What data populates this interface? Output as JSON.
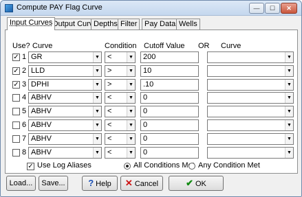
{
  "window": {
    "title": "Compute PAY Flag Curve",
    "min_glyph": "—",
    "max_glyph": "☐",
    "close_glyph": "✕"
  },
  "tabs": [
    "Input Curves",
    "Output Curve",
    "Depths",
    "Filter",
    "Pay Data",
    "Wells"
  ],
  "headers": {
    "use": "Use?",
    "curve": "Curve",
    "condition": "Condition",
    "cutoff": "Cutoff Value",
    "or": "OR",
    "curve2": "Curve"
  },
  "rows": [
    {
      "checked": true,
      "num": "1",
      "curve": "GR",
      "condition": "<",
      "cutoff": "200",
      "alt_curve": ""
    },
    {
      "checked": true,
      "num": "2",
      "curve": "LLD",
      "condition": ">",
      "cutoff": "10",
      "alt_curve": ""
    },
    {
      "checked": true,
      "num": "3",
      "curve": "DPHI",
      "condition": ">",
      "cutoff": ".10",
      "alt_curve": ""
    },
    {
      "checked": false,
      "num": "4",
      "curve": "ABHV",
      "condition": "<",
      "cutoff": "0",
      "alt_curve": ""
    },
    {
      "checked": false,
      "num": "5",
      "curve": "ABHV",
      "condition": "<",
      "cutoff": "0",
      "alt_curve": ""
    },
    {
      "checked": false,
      "num": "6",
      "curve": "ABHV",
      "condition": "<",
      "cutoff": "0",
      "alt_curve": ""
    },
    {
      "checked": false,
      "num": "7",
      "curve": "ABHV",
      "condition": "<",
      "cutoff": "0",
      "alt_curve": ""
    },
    {
      "checked": false,
      "num": "8",
      "curve": "ABHV",
      "condition": "<",
      "cutoff": "0",
      "alt_curve": ""
    }
  ],
  "options": {
    "use_log_aliases": "Use Log Aliases",
    "use_log_aliases_checked": true,
    "all_conditions": "All Conditions Met",
    "any_condition": "Any Condition Met",
    "selected_mode": "all"
  },
  "buttons": {
    "load": "Load...",
    "save": "Save...",
    "help": "Help",
    "cancel": "Cancel",
    "ok": "OK",
    "help_icon": "?",
    "cancel_icon": "✕",
    "ok_icon": "✔"
  },
  "colors": {
    "help_icon": "#1a4fb5",
    "cancel_icon": "#cc1111",
    "ok_icon": "#118a11"
  }
}
